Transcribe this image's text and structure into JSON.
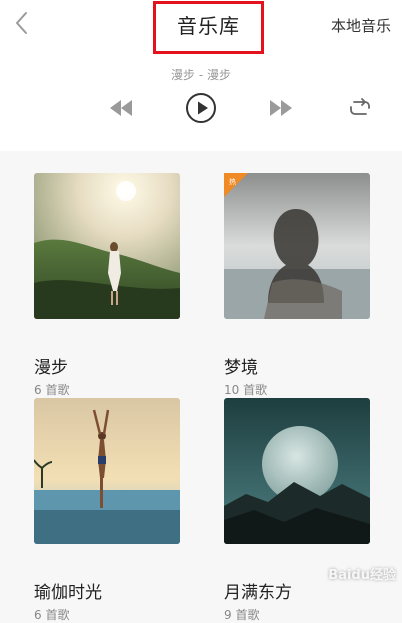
{
  "header": {
    "title": "音乐库",
    "local_music_label": "本地音乐"
  },
  "player": {
    "now_playing": "漫步 - 漫步"
  },
  "playlists": [
    {
      "name": "漫步",
      "count": "6 首歌"
    },
    {
      "name": "梦境",
      "count": "10 首歌",
      "badge": "热"
    },
    {
      "name": "瑜伽时光",
      "count": "6 首歌"
    },
    {
      "name": "月满东方",
      "count": "9 首歌"
    }
  ],
  "watermark": "Baidu经验",
  "colors": {
    "highlight_box": "#e4121c",
    "badge": "#f08a24",
    "icon_gray": "#9a9a9a",
    "icon_dark": "#333333"
  }
}
